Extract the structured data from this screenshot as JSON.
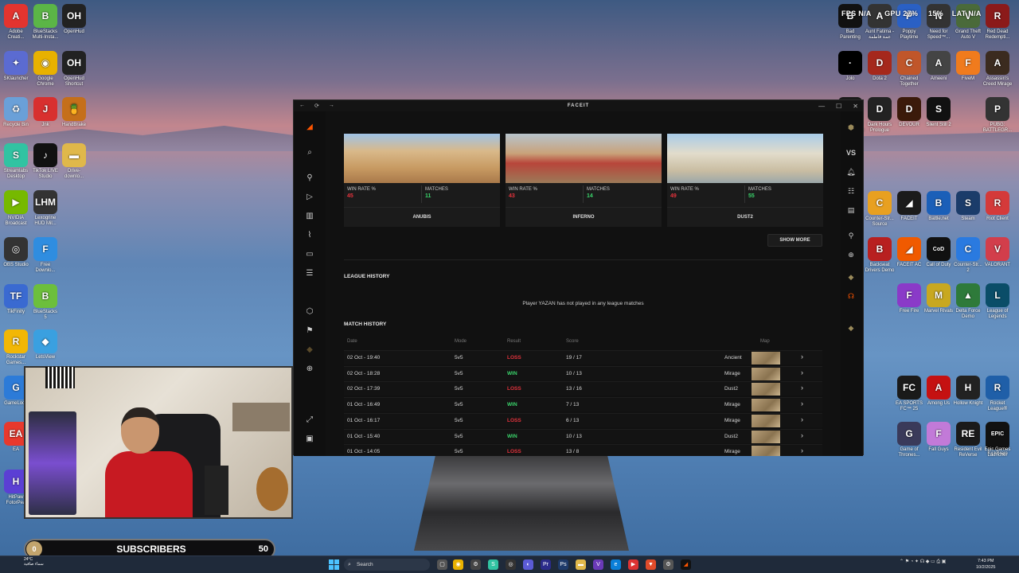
{
  "osd": {
    "fps": "FPS N/A",
    "gpu": "GPU 27%",
    "cpu": "15%",
    "lat": "LAT N/A"
  },
  "desktop_left": [
    {
      "label": "Adobe Creati...",
      "color": "#e3342f",
      "glyph": "A"
    },
    {
      "label": "BlueStacks Multi-Insta...",
      "color": "#5bb547",
      "glyph": "B"
    },
    {
      "label": "OpenHud",
      "color": "#222",
      "glyph": "OH"
    },
    {
      "label": "SKlauncher",
      "color": "#5b6bd1",
      "glyph": "✦"
    },
    {
      "label": "Google Chrome",
      "color": "#e8b100",
      "glyph": "◉"
    },
    {
      "label": "OpenHud Shortcut",
      "color": "#222",
      "glyph": "OH"
    },
    {
      "label": "Recycle Bin",
      "color": "#6aa0d8",
      "glyph": "♻"
    },
    {
      "label": "Jnk",
      "color": "#d8302f",
      "glyph": "J"
    },
    {
      "label": "HandBrake",
      "color": "#c56f1a",
      "glyph": "🍍"
    },
    {
      "label": "Streamlabs Desktop",
      "color": "#31c3a2",
      "glyph": "S"
    },
    {
      "label": "TikTok LIVE Studio",
      "color": "#111",
      "glyph": "♪"
    },
    {
      "label": "Drive-downlo...",
      "color": "#e0b84a",
      "glyph": "▬"
    },
    {
      "label": "NVIDIA Broadcast",
      "color": "#76b900",
      "glyph": "▶"
    },
    {
      "label": "Lexogrine HUD Mil...",
      "color": "#333",
      "glyph": "LHM"
    },
    {
      "label": "OBS Studio",
      "color": "#333",
      "glyph": "◎"
    },
    {
      "label": "Free Downlo...",
      "color": "#2f8de0",
      "glyph": "F"
    },
    {
      "label": "TikFinity",
      "color": "#3a6ad1",
      "glyph": "TF"
    },
    {
      "label": "BlueStacks 5",
      "color": "#6cbf3c",
      "glyph": "B"
    },
    {
      "label": "Rockstar Games...",
      "color": "#f2b705",
      "glyph": "R"
    },
    {
      "label": "LetsView",
      "color": "#3aa0e0",
      "glyph": "◆"
    },
    {
      "label": "GameLoop",
      "color": "#2c7bd8",
      "glyph": "G"
    },
    {
      "label": "EA",
      "color": "#e8392d",
      "glyph": "EA"
    },
    {
      "label": "HitPaw FotorPea",
      "color": "#5b3fd4",
      "glyph": "H"
    }
  ],
  "desktop_right": [
    {
      "label": "Bad Parenting",
      "color": "#111",
      "glyph": "B"
    },
    {
      "label": "Aunt Fatima - عمة فاطمة",
      "color": "#333",
      "glyph": "A"
    },
    {
      "label": "Poppy Playtime",
      "color": "#2a60c4",
      "glyph": "P"
    },
    {
      "label": "Need for Speed™...",
      "color": "#333",
      "glyph": "N"
    },
    {
      "label": "Grand Theft Auto V",
      "color": "#4a6a3a",
      "glyph": "V"
    },
    {
      "label": "Red Dead Redempti...",
      "color": "#8b1a1a",
      "glyph": "R"
    },
    {
      "label": "Jolo",
      "color": "#000",
      "glyph": "·"
    },
    {
      "label": "Dota 2",
      "color": "#a5281c",
      "glyph": "D"
    },
    {
      "label": "Chained Together",
      "color": "#c0562a",
      "glyph": "C"
    },
    {
      "label": "Ameeni",
      "color": "#444",
      "glyph": "A"
    },
    {
      "label": "FiveM",
      "color": "#f07b1d",
      "glyph": "F"
    },
    {
      "label": "Assassin's Creed Mirage",
      "color": "#3b2b1f",
      "glyph": "A"
    },
    {
      "label": "Eyes The Horror Game",
      "color": "#1a1a1a",
      "glyph": "E"
    },
    {
      "label": "Dark Hours Prologue",
      "color": "#222",
      "glyph": "D"
    },
    {
      "label": "DEVOUR",
      "color": "#3b1a0a",
      "glyph": "D"
    },
    {
      "label": "Silent Still 2",
      "color": "#111",
      "glyph": "S"
    },
    {
      "label": "PUBG: BATTLEGR...",
      "color": "#333",
      "glyph": "P"
    },
    {
      "label": "Counter-Str... Source",
      "color": "#e8a020",
      "glyph": "C"
    },
    {
      "label": "FACEIT",
      "color": "#1b1b1b",
      "glyph": "◢"
    },
    {
      "label": "Battle.net",
      "color": "#1b5fb8",
      "glyph": "B"
    },
    {
      "label": "Steam",
      "color": "#1b3c6a",
      "glyph": "S"
    },
    {
      "label": "Riot Client",
      "color": "#d43a3a",
      "glyph": "R"
    },
    {
      "label": "Backseat Drivers Demo",
      "color": "#b82020",
      "glyph": "B"
    },
    {
      "label": "FACEIT AC",
      "color": "#f05a00",
      "glyph": "◢"
    },
    {
      "label": "Call of Duty",
      "color": "#111",
      "glyph": "CoD"
    },
    {
      "label": "Counter-Str... 2",
      "color": "#2a7ae0",
      "glyph": "C"
    },
    {
      "label": "VALORANT",
      "color": "#d23e4b",
      "glyph": "V"
    },
    {
      "label": "Free Fire",
      "color": "#8a3ac8",
      "glyph": "F"
    },
    {
      "label": "Marvel Rivals",
      "color": "#c8a820",
      "glyph": "M"
    },
    {
      "label": "Delta Force Demo",
      "color": "#2e7a3a",
      "glyph": "▲"
    },
    {
      "label": "League of Legends",
      "color": "#0a4d68",
      "glyph": "L"
    },
    {
      "label": "EA SPORTS FC™ 25",
      "color": "#1a1a1a",
      "glyph": "FC"
    },
    {
      "label": "Among Us",
      "color": "#c51111",
      "glyph": "A"
    },
    {
      "label": "Hollow Knight",
      "color": "#222",
      "glyph": "H"
    },
    {
      "label": "Rocket League®",
      "color": "#1f5fa8",
      "glyph": "R"
    },
    {
      "label": "KickBrain",
      "color": "#111",
      "glyph": "K"
    },
    {
      "label": "Game of Thrones...",
      "color": "#3a3a5a",
      "glyph": "G"
    },
    {
      "label": "Fall Guys",
      "color": "#c27ad8",
      "glyph": "F"
    },
    {
      "label": "Resident Evil ReVerse",
      "color": "#1a1a1a",
      "glyph": "RE"
    },
    {
      "label": "Epic Games Launcher",
      "color": "#111",
      "glyph": "EPIC"
    }
  ],
  "window": {
    "title": "FACEIT",
    "back": "←",
    "reload": "⟳",
    "forward": "→",
    "minimize": "—",
    "maximize": "☐",
    "close": "✕"
  },
  "maps": [
    {
      "name": "ANUBIS",
      "win_rate_label": "WIN RATE %",
      "win_rate": "45",
      "matches_label": "MATCHES",
      "matches": "11"
    },
    {
      "name": "INFERNO",
      "win_rate_label": "WIN RATE %",
      "win_rate": "43",
      "matches_label": "MATCHES",
      "matches": "14"
    },
    {
      "name": "DUST2",
      "win_rate_label": "WIN RATE %",
      "win_rate": "49",
      "matches_label": "MATCHES",
      "matches": "55"
    }
  ],
  "show_more": "SHOW MORE",
  "league_history": {
    "title": "LEAGUE HISTORY",
    "notice": "Player YAZAN has not played in any league matches"
  },
  "match_history": {
    "title": "MATCH HISTORY",
    "columns": {
      "date": "Date",
      "mode": "Mode",
      "result": "Result",
      "score": "Score",
      "map": "Map"
    },
    "rows": [
      {
        "date": "02 Oct - 19:40",
        "mode": "5v5",
        "result": "LOSS",
        "score": "19 / 17",
        "map": "Ancient"
      },
      {
        "date": "02 Oct - 18:28",
        "mode": "5v5",
        "result": "WIN",
        "score": "10 / 13",
        "map": "Mirage"
      },
      {
        "date": "02 Oct - 17:39",
        "mode": "5v5",
        "result": "LOSS",
        "score": "13 / 16",
        "map": "Dust2"
      },
      {
        "date": "01 Oct - 16:49",
        "mode": "5v5",
        "result": "WIN",
        "score": "7 / 13",
        "map": "Mirage"
      },
      {
        "date": "01 Oct - 16:17",
        "mode": "5v5",
        "result": "LOSS",
        "score": "6 / 13",
        "map": "Mirage"
      },
      {
        "date": "01 Oct - 15:40",
        "mode": "5v5",
        "result": "WIN",
        "score": "10 / 13",
        "map": "Dust2"
      },
      {
        "date": "01 Oct - 14:05",
        "mode": "5v5",
        "result": "LOSS",
        "score": "13 / 8",
        "map": "Mirage"
      }
    ]
  },
  "right_nav_vs": "VS",
  "subscribers": {
    "progress": "0",
    "label": "SUBSCRIBERS",
    "goal": "50"
  },
  "taskbar": {
    "search": "Search",
    "time": "7:43 PM",
    "date": "10/2/2025",
    "weather_temp": "24°C",
    "weather_text": "سماء صافية"
  },
  "colors": {
    "faceit_orange": "#ff5500",
    "loss": "#e5333d",
    "win": "#3ad46b"
  }
}
